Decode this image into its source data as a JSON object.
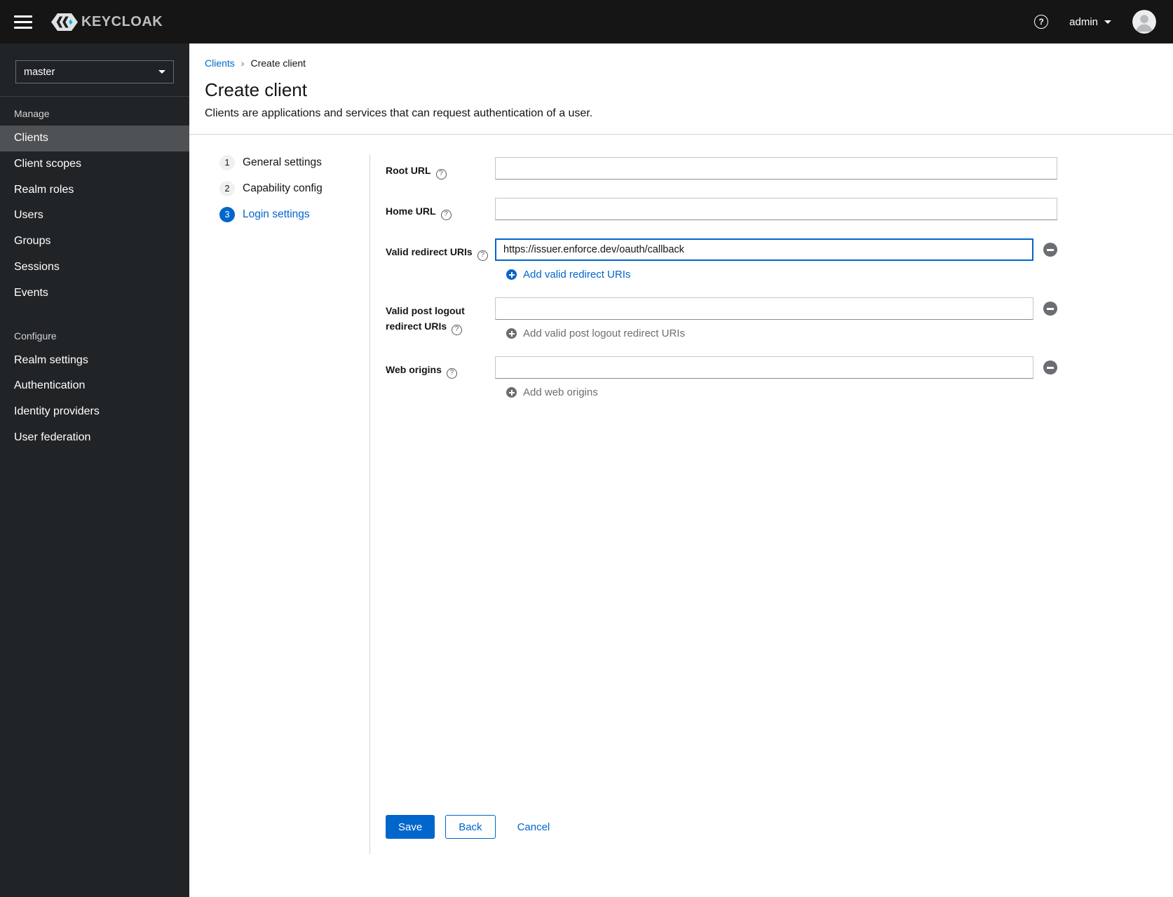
{
  "colors": {
    "primary": "#0066cc",
    "masthead_bg": "#151515",
    "sidebar_bg": "#212427",
    "nav_selected_bg": "#4f5255",
    "muted": "#6a6e73",
    "divider": "#d2d2d2"
  },
  "topbar": {
    "brand": "KEYCLOAK",
    "user": "admin"
  },
  "sidebar": {
    "realm": "master",
    "sections": [
      {
        "title": "Manage",
        "items": [
          {
            "label": "Clients",
            "current": true
          },
          {
            "label": "Client scopes"
          },
          {
            "label": "Realm roles"
          },
          {
            "label": "Users"
          },
          {
            "label": "Groups"
          },
          {
            "label": "Sessions"
          },
          {
            "label": "Events"
          }
        ]
      },
      {
        "title": "Configure",
        "items": [
          {
            "label": "Realm settings"
          },
          {
            "label": "Authentication"
          },
          {
            "label": "Identity providers"
          },
          {
            "label": "User federation"
          }
        ]
      }
    ]
  },
  "breadcrumb": {
    "link": "Clients",
    "separator": "›",
    "current": "Create client"
  },
  "page": {
    "title": "Create client",
    "subtitle": "Clients are applications and services that can request authentication of a user."
  },
  "wizard": {
    "steps": [
      {
        "num": "1",
        "label": "General settings"
      },
      {
        "num": "2",
        "label": "Capability config"
      },
      {
        "num": "3",
        "label": "Login settings",
        "active": true
      }
    ]
  },
  "form": {
    "root_url": {
      "label": "Root URL",
      "value": ""
    },
    "home_url": {
      "label": "Home URL",
      "value": ""
    },
    "redirect_uris": {
      "label": "Valid redirect URIs",
      "value": "https://issuer.enforce.dev/oauth/callback",
      "add_label": "Add valid redirect URIs"
    },
    "post_logout_uris": {
      "label": "Valid post logout redirect URIs",
      "value": "",
      "add_label": "Add valid post logout redirect URIs"
    },
    "web_origins": {
      "label": "Web origins",
      "value": "",
      "add_label": "Add web origins"
    }
  },
  "actions": {
    "save": "Save",
    "back": "Back",
    "cancel": "Cancel"
  }
}
